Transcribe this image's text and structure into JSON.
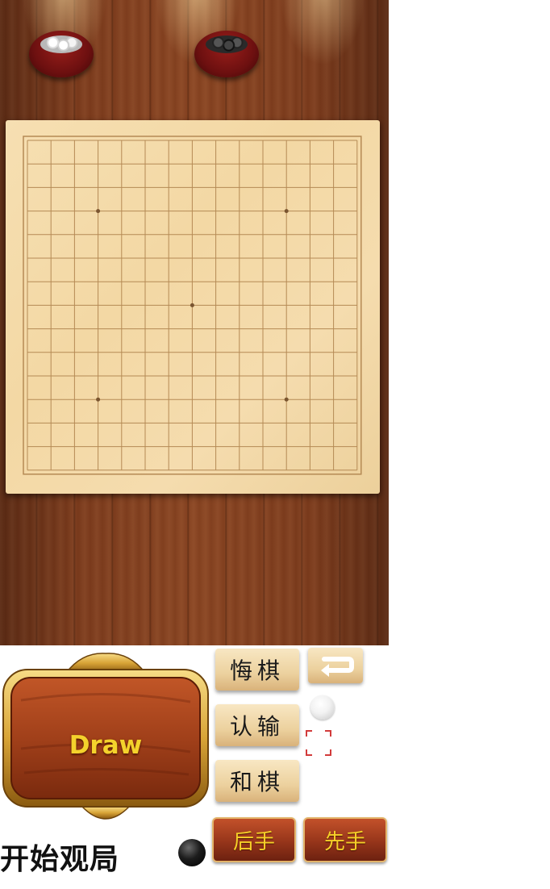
{
  "board": {
    "size": 15,
    "star_points": [
      [
        3,
        3
      ],
      [
        11,
        3
      ],
      [
        7,
        7
      ],
      [
        3,
        11
      ],
      [
        11,
        11
      ]
    ]
  },
  "status": {
    "result_text": "Draw"
  },
  "buttons": {
    "undo_label": "悔棋",
    "resign_label": "认输",
    "draw_label": "和棋",
    "second_hand_label": "后手",
    "first_hand_label": "先手"
  },
  "footer": {
    "watch_label": "开始观局"
  },
  "colors": {
    "result_text": "#f4d22c",
    "wood": "#7d3c1d",
    "board": "#f3d8a4",
    "grid": "#b58a55"
  }
}
